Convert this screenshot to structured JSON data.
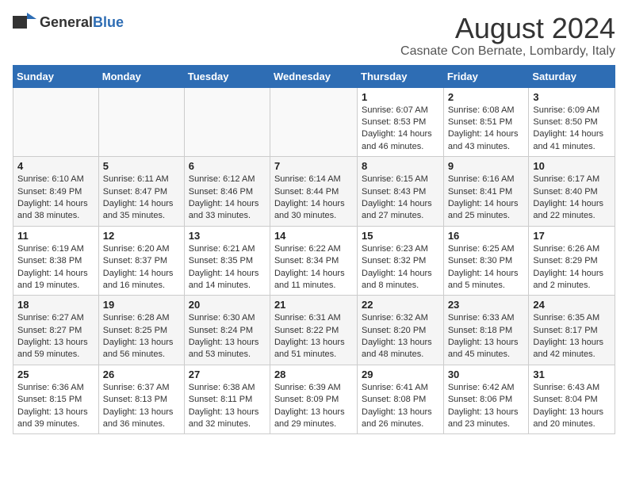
{
  "header": {
    "logo_general": "General",
    "logo_blue": "Blue",
    "month": "August 2024",
    "location": "Casnate Con Bernate, Lombardy, Italy"
  },
  "days_of_week": [
    "Sunday",
    "Monday",
    "Tuesday",
    "Wednesday",
    "Thursday",
    "Friday",
    "Saturday"
  ],
  "weeks": [
    [
      {
        "day": "",
        "content": ""
      },
      {
        "day": "",
        "content": ""
      },
      {
        "day": "",
        "content": ""
      },
      {
        "day": "",
        "content": ""
      },
      {
        "day": "1",
        "content": "Sunrise: 6:07 AM\nSunset: 8:53 PM\nDaylight: 14 hours\nand 46 minutes."
      },
      {
        "day": "2",
        "content": "Sunrise: 6:08 AM\nSunset: 8:51 PM\nDaylight: 14 hours\nand 43 minutes."
      },
      {
        "day": "3",
        "content": "Sunrise: 6:09 AM\nSunset: 8:50 PM\nDaylight: 14 hours\nand 41 minutes."
      }
    ],
    [
      {
        "day": "4",
        "content": "Sunrise: 6:10 AM\nSunset: 8:49 PM\nDaylight: 14 hours\nand 38 minutes."
      },
      {
        "day": "5",
        "content": "Sunrise: 6:11 AM\nSunset: 8:47 PM\nDaylight: 14 hours\nand 35 minutes."
      },
      {
        "day": "6",
        "content": "Sunrise: 6:12 AM\nSunset: 8:46 PM\nDaylight: 14 hours\nand 33 minutes."
      },
      {
        "day": "7",
        "content": "Sunrise: 6:14 AM\nSunset: 8:44 PM\nDaylight: 14 hours\nand 30 minutes."
      },
      {
        "day": "8",
        "content": "Sunrise: 6:15 AM\nSunset: 8:43 PM\nDaylight: 14 hours\nand 27 minutes."
      },
      {
        "day": "9",
        "content": "Sunrise: 6:16 AM\nSunset: 8:41 PM\nDaylight: 14 hours\nand 25 minutes."
      },
      {
        "day": "10",
        "content": "Sunrise: 6:17 AM\nSunset: 8:40 PM\nDaylight: 14 hours\nand 22 minutes."
      }
    ],
    [
      {
        "day": "11",
        "content": "Sunrise: 6:19 AM\nSunset: 8:38 PM\nDaylight: 14 hours\nand 19 minutes."
      },
      {
        "day": "12",
        "content": "Sunrise: 6:20 AM\nSunset: 8:37 PM\nDaylight: 14 hours\nand 16 minutes."
      },
      {
        "day": "13",
        "content": "Sunrise: 6:21 AM\nSunset: 8:35 PM\nDaylight: 14 hours\nand 14 minutes."
      },
      {
        "day": "14",
        "content": "Sunrise: 6:22 AM\nSunset: 8:34 PM\nDaylight: 14 hours\nand 11 minutes."
      },
      {
        "day": "15",
        "content": "Sunrise: 6:23 AM\nSunset: 8:32 PM\nDaylight: 14 hours\nand 8 minutes."
      },
      {
        "day": "16",
        "content": "Sunrise: 6:25 AM\nSunset: 8:30 PM\nDaylight: 14 hours\nand 5 minutes."
      },
      {
        "day": "17",
        "content": "Sunrise: 6:26 AM\nSunset: 8:29 PM\nDaylight: 14 hours\nand 2 minutes."
      }
    ],
    [
      {
        "day": "18",
        "content": "Sunrise: 6:27 AM\nSunset: 8:27 PM\nDaylight: 13 hours\nand 59 minutes."
      },
      {
        "day": "19",
        "content": "Sunrise: 6:28 AM\nSunset: 8:25 PM\nDaylight: 13 hours\nand 56 minutes."
      },
      {
        "day": "20",
        "content": "Sunrise: 6:30 AM\nSunset: 8:24 PM\nDaylight: 13 hours\nand 53 minutes."
      },
      {
        "day": "21",
        "content": "Sunrise: 6:31 AM\nSunset: 8:22 PM\nDaylight: 13 hours\nand 51 minutes."
      },
      {
        "day": "22",
        "content": "Sunrise: 6:32 AM\nSunset: 8:20 PM\nDaylight: 13 hours\nand 48 minutes."
      },
      {
        "day": "23",
        "content": "Sunrise: 6:33 AM\nSunset: 8:18 PM\nDaylight: 13 hours\nand 45 minutes."
      },
      {
        "day": "24",
        "content": "Sunrise: 6:35 AM\nSunset: 8:17 PM\nDaylight: 13 hours\nand 42 minutes."
      }
    ],
    [
      {
        "day": "25",
        "content": "Sunrise: 6:36 AM\nSunset: 8:15 PM\nDaylight: 13 hours\nand 39 minutes."
      },
      {
        "day": "26",
        "content": "Sunrise: 6:37 AM\nSunset: 8:13 PM\nDaylight: 13 hours\nand 36 minutes."
      },
      {
        "day": "27",
        "content": "Sunrise: 6:38 AM\nSunset: 8:11 PM\nDaylight: 13 hours\nand 32 minutes."
      },
      {
        "day": "28",
        "content": "Sunrise: 6:39 AM\nSunset: 8:09 PM\nDaylight: 13 hours\nand 29 minutes."
      },
      {
        "day": "29",
        "content": "Sunrise: 6:41 AM\nSunset: 8:08 PM\nDaylight: 13 hours\nand 26 minutes."
      },
      {
        "day": "30",
        "content": "Sunrise: 6:42 AM\nSunset: 8:06 PM\nDaylight: 13 hours\nand 23 minutes."
      },
      {
        "day": "31",
        "content": "Sunrise: 6:43 AM\nSunset: 8:04 PM\nDaylight: 13 hours\nand 20 minutes."
      }
    ]
  ]
}
